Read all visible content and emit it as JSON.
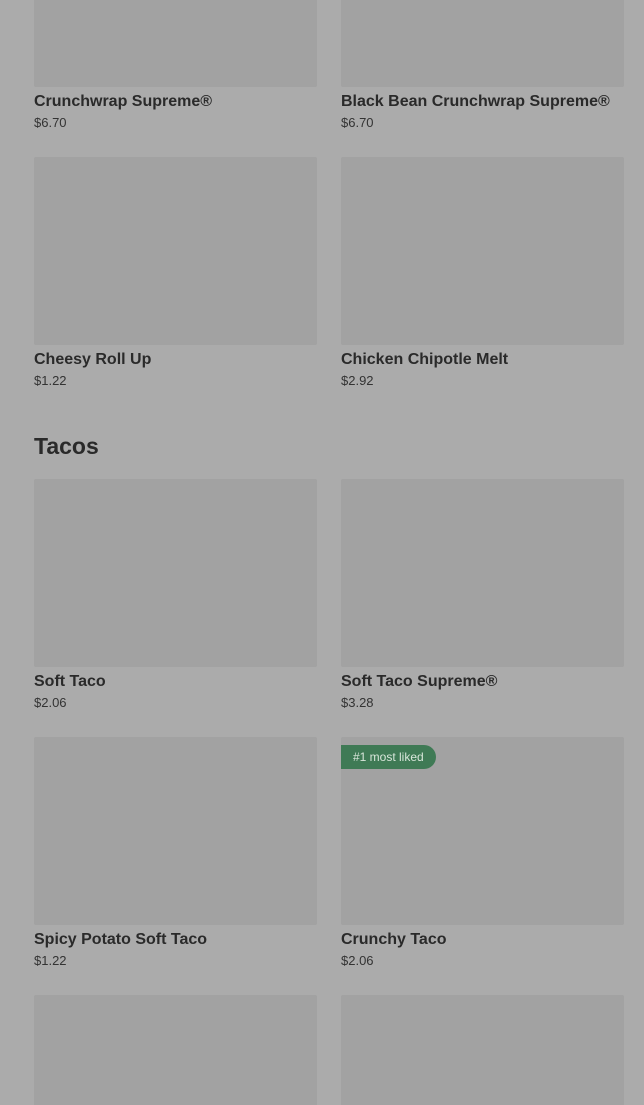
{
  "sections": {
    "burritos_items": [
      {
        "name": "Crunchwrap Supreme®",
        "price": "$6.70"
      },
      {
        "name": "Black Bean Crunchwrap Supreme®",
        "price": "$6.70"
      },
      {
        "name": "Cheesy Roll Up",
        "price": "$1.22"
      },
      {
        "name": "Chicken Chipotle Melt",
        "price": "$2.92"
      }
    ],
    "tacos": {
      "title": "Tacos",
      "items": [
        {
          "name": "Soft Taco",
          "price": "$2.06"
        },
        {
          "name": "Soft Taco Supreme®",
          "price": "$3.28"
        },
        {
          "name": "Spicy Potato Soft Taco",
          "price": "$1.22"
        },
        {
          "name": "Crunchy Taco",
          "price": "$2.06",
          "badge": "#1 most liked"
        }
      ]
    }
  },
  "colors": {
    "overlay_background": "#ababab",
    "thumbnail": "#a2a2a2",
    "badge_background": "#3f7a55"
  }
}
